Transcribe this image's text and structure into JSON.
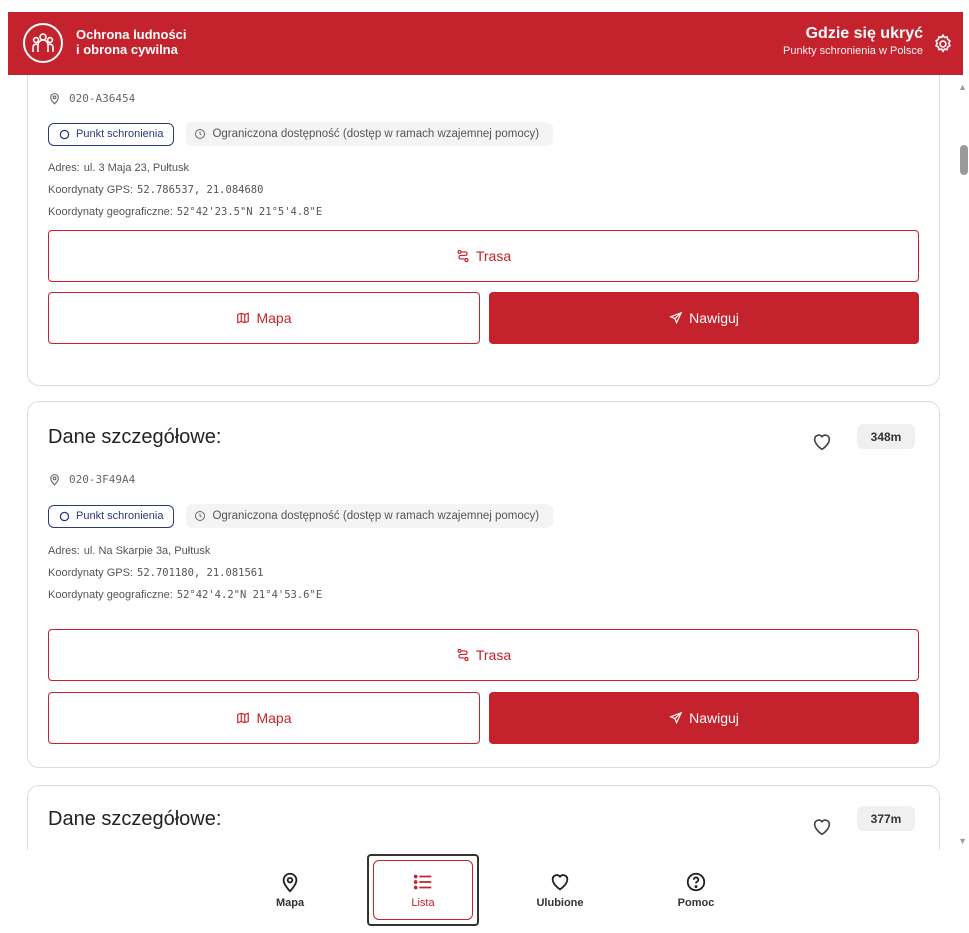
{
  "header": {
    "brand_line1": "Ochrona ludności",
    "brand_line2": "i obrona cywilna",
    "title": "Gdzie się ukryć",
    "subtitle": "Punkty schronienia w Polsce"
  },
  "cards": [
    {
      "title": "",
      "distance": "",
      "code": "020-A36454",
      "type": "Punkt schronienia",
      "access": "Ograniczona dostępność (dostęp w ramach wzajemnej pomocy)",
      "address_label": "Adres:",
      "address": "ul. 3 Maja 23, Pułtusk",
      "gps_label": "Koordynaty GPS:",
      "gps": "52.786537, 21.084680",
      "geo_label": "Koordynaty geograficzne:",
      "geo": "52°42'23.5\"N 21°5'4.8\"E",
      "route_label": "Trasa",
      "map_label": "Mapa",
      "navigate_label": "Nawiguj"
    },
    {
      "title": "Dane szczegółowe:",
      "distance": "348m",
      "code": "020-3F49A4",
      "type": "Punkt schronienia",
      "access": "Ograniczona dostępność (dostęp w ramach wzajemnej pomocy)",
      "address_label": "Adres:",
      "address": "ul. Na Skarpie 3a, Pułtusk",
      "gps_label": "Koordynaty GPS:",
      "gps": "52.701180, 21.081561",
      "geo_label": "Koordynaty geograficzne:",
      "geo": "52°42'4.2\"N 21°4'53.6\"E",
      "route_label": "Trasa",
      "map_label": "Mapa",
      "navigate_label": "Nawiguj"
    },
    {
      "title": "Dane szczegółowe:",
      "distance": "377m"
    }
  ],
  "nav": {
    "items": [
      {
        "label": "Mapa",
        "icon": "map-pin-icon"
      },
      {
        "label": "Lista",
        "icon": "list-icon"
      },
      {
        "label": "Ulubione",
        "icon": "heart-icon"
      },
      {
        "label": "Pomoc",
        "icon": "help-icon"
      }
    ],
    "active_index": 1
  },
  "colors": {
    "brand_red": "#c4222c",
    "badge_navy": "#2a3a7a"
  }
}
